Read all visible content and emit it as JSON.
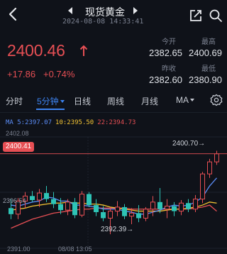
{
  "header": {
    "title": "现货黄金",
    "datetime": "2024-08-08 14:33:41"
  },
  "quote": {
    "price": "2400.46",
    "change": "+17.86",
    "change_pct": "+0.74%",
    "up_color": "#e64f54",
    "down_color": "#2ec4b6",
    "open_label": "今开",
    "open": "2382.65",
    "high_label": "最高",
    "high": "2400.69",
    "prev_close_label": "昨收",
    "prev_close": "2382.60",
    "low_label": "最低",
    "low": "2380.90"
  },
  "tabs": [
    {
      "label": "分时"
    },
    {
      "label": "5分钟"
    },
    {
      "label": "日线"
    },
    {
      "label": "周线"
    },
    {
      "label": "月线"
    },
    {
      "label": "MA"
    }
  ],
  "active_tab": "5分钟",
  "ma_indicators": [
    {
      "label": "MA 5:2397.07",
      "color": "#5b8cf5"
    },
    {
      "label": "10:2395.50",
      "color": "#f2c233"
    },
    {
      "label": "22:2394.73",
      "color": "#e64f54"
    }
  ],
  "chart_data": {
    "type": "candlestick",
    "y_axis_top_label": "2402.08",
    "y_axis_mid_label": "2396.54",
    "y_axis_bottom_label": "2391.00",
    "ylim": [
      2391.0,
      2402.08
    ],
    "x_time_label": "08/08 13:05",
    "current_price_label": "2400.41",
    "high_annotation": "2400.70",
    "low_annotation": "2392.39",
    "candles": [
      {
        "o": 2395.0,
        "h": 2395.9,
        "l": 2393.9,
        "c": 2394.4
      },
      {
        "o": 2394.4,
        "h": 2396.0,
        "l": 2393.9,
        "c": 2395.7
      },
      {
        "o": 2395.7,
        "h": 2396.6,
        "l": 2395.0,
        "c": 2396.2
      },
      {
        "o": 2396.2,
        "h": 2396.7,
        "l": 2395.6,
        "c": 2395.8
      },
      {
        "o": 2395.8,
        "h": 2396.9,
        "l": 2395.1,
        "c": 2396.5
      },
      {
        "o": 2396.5,
        "h": 2397.2,
        "l": 2395.6,
        "c": 2395.9
      },
      {
        "o": 2395.9,
        "h": 2396.6,
        "l": 2395.0,
        "c": 2395.4
      },
      {
        "o": 2395.4,
        "h": 2396.0,
        "l": 2394.4,
        "c": 2394.8
      },
      {
        "o": 2394.8,
        "h": 2395.9,
        "l": 2394.3,
        "c": 2395.6
      },
      {
        "o": 2395.6,
        "h": 2396.0,
        "l": 2394.0,
        "c": 2394.3
      },
      {
        "o": 2394.3,
        "h": 2396.7,
        "l": 2394.1,
        "c": 2396.4
      },
      {
        "o": 2396.4,
        "h": 2396.6,
        "l": 2395.1,
        "c": 2395.3
      },
      {
        "o": 2395.3,
        "h": 2395.9,
        "l": 2394.2,
        "c": 2394.6
      },
      {
        "o": 2394.6,
        "h": 2395.2,
        "l": 2393.7,
        "c": 2394.0
      },
      {
        "o": 2394.0,
        "h": 2395.1,
        "l": 2392.4,
        "c": 2394.7
      },
      {
        "o": 2394.7,
        "h": 2395.7,
        "l": 2394.2,
        "c": 2395.1
      },
      {
        "o": 2395.1,
        "h": 2395.4,
        "l": 2393.9,
        "c": 2394.2
      },
      {
        "o": 2394.2,
        "h": 2395.0,
        "l": 2393.4,
        "c": 2394.5
      },
      {
        "o": 2394.5,
        "h": 2395.3,
        "l": 2393.6,
        "c": 2394.0
      },
      {
        "o": 2394.0,
        "h": 2395.1,
        "l": 2393.7,
        "c": 2394.9
      },
      {
        "o": 2394.9,
        "h": 2396.2,
        "l": 2394.2,
        "c": 2395.6
      },
      {
        "o": 2395.6,
        "h": 2397.0,
        "l": 2394.5,
        "c": 2394.9
      },
      {
        "o": 2394.9,
        "h": 2395.9,
        "l": 2394.0,
        "c": 2395.2
      },
      {
        "o": 2395.2,
        "h": 2395.6,
        "l": 2394.2,
        "c": 2394.7
      },
      {
        "o": 2394.7,
        "h": 2395.8,
        "l": 2394.3,
        "c": 2395.5
      },
      {
        "o": 2395.5,
        "h": 2395.9,
        "l": 2394.6,
        "c": 2394.9
      },
      {
        "o": 2394.9,
        "h": 2396.3,
        "l": 2394.6,
        "c": 2395.9
      },
      {
        "o": 2395.9,
        "h": 2398.6,
        "l": 2395.5,
        "c": 2398.4
      },
      {
        "o": 2398.4,
        "h": 2399.9,
        "l": 2398.0,
        "c": 2399.6
      },
      {
        "o": 2399.6,
        "h": 2400.7,
        "l": 2399.3,
        "c": 2400.4
      }
    ],
    "ma5": [
      2395.3,
      2395.2,
      2395.4,
      2395.6,
      2395.7,
      2396.1,
      2396.0,
      2395.7,
      2395.7,
      2395.3,
      2395.3,
      2395.2,
      2395.1,
      2394.9,
      2394.9,
      2394.9,
      2394.7,
      2394.6,
      2394.4,
      2394.4,
      2394.6,
      2394.8,
      2395.1,
      2395.3,
      2395.2,
      2395.3,
      2395.6,
      2396.1,
      2397.2,
      2398.0
    ],
    "ma10": [
      2394.8,
      2394.9,
      2395.0,
      2395.2,
      2395.3,
      2395.4,
      2395.5,
      2395.5,
      2395.6,
      2395.5,
      2395.5,
      2395.4,
      2395.4,
      2395.3,
      2395.1,
      2395.0,
      2394.9,
      2394.8,
      2394.7,
      2394.7,
      2394.7,
      2394.7,
      2394.8,
      2394.9,
      2394.9,
      2395.0,
      2395.1,
      2395.3,
      2395.6,
      2395.5
    ],
    "ma22": [
      2393.0,
      2393.3,
      2393.6,
      2393.9,
      2394.1,
      2394.3,
      2394.5,
      2394.6,
      2394.7,
      2394.8,
      2394.9,
      2394.9,
      2395.0,
      2395.0,
      2395.0,
      2395.0,
      2395.0,
      2394.9,
      2394.9,
      2394.9,
      2394.9,
      2394.9,
      2394.9,
      2394.9,
      2394.9,
      2394.9,
      2395.0,
      2395.1,
      2395.3,
      2394.7
    ]
  }
}
